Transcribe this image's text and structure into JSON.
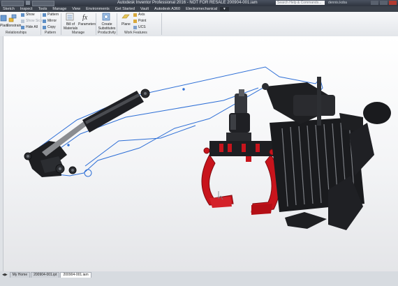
{
  "titlebar": {
    "quick_access_left": "Material",
    "quick_access_mid": "Default",
    "title": "Autodesk Inventor Professional 2016 - NOT FOR RESALE  200904-001.iam",
    "search_placeholder": "Search Help & Commands...",
    "user": "dennis.koba"
  },
  "menu": {
    "tabs": [
      "Sketch",
      "Inspect",
      "Tools",
      "Manage",
      "View",
      "Environments",
      "Get Started",
      "Vault",
      "Autodesk A360",
      "Electromechanical"
    ]
  },
  "ribbon": {
    "place": "Place",
    "constrain": "Constrain",
    "show": "Show",
    "show_sick": "Show Sick",
    "hide_all": "Hide All",
    "pattern": "Pattern",
    "mirror": "Mirror",
    "copy": "Copy",
    "bill_of_materials": "Bill of Materials",
    "parameters": "Parameters",
    "create_substitutes": "Create Substitutes",
    "plane": "Plane",
    "axis": "Axis",
    "point": "Point",
    "ucs": "UCS",
    "groups": {
      "relationships": "Relationships",
      "pattern": "Pattern",
      "manage": "Manage",
      "productivity": "Productivity",
      "work_features": "Work Features"
    }
  },
  "doctabs": {
    "home": "My Home",
    "tab1": "200904-001.ipt",
    "tab2": "200904-001.iam"
  },
  "colors": {
    "sketch_lines": "#2e6fd6",
    "grapple_red": "#c8141c",
    "dark_metal": "#1e1f22"
  }
}
